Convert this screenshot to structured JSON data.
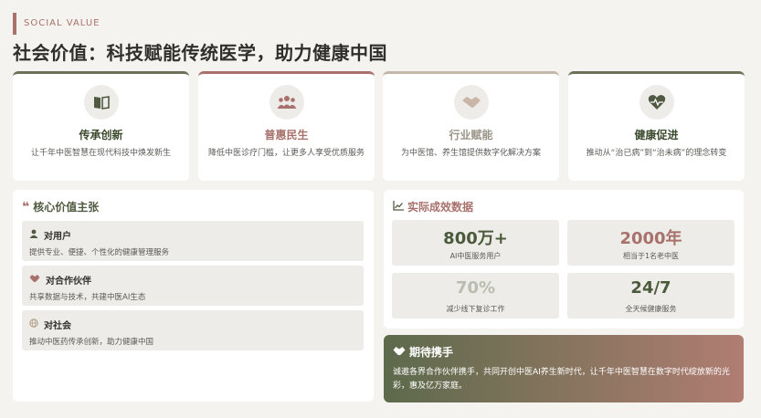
{
  "header": {
    "eyebrow": "SOCIAL VALUE",
    "title": "社会价值：科技赋能传统医学，助力健康中国"
  },
  "cards": [
    {
      "icon": "book-icon",
      "title": "传承创新",
      "desc": "让千年中医智慧在现代科技中焕发新生",
      "accent": "#6b7258"
    },
    {
      "icon": "users-icon",
      "title": "普惠民生",
      "desc": "降低中医诊疗门槛，让更多人享受优质服务",
      "accent": "#a8716b"
    },
    {
      "icon": "handshake-icon",
      "title": "行业赋能",
      "desc": "为中医馆、养生馆提供数字化解决方案",
      "accent": "#c4b8a8"
    },
    {
      "icon": "heart-pulse-icon",
      "title": "健康促进",
      "desc": "推动从“治已病”到“治未病”的理念转变",
      "accent": "#6b7258"
    }
  ],
  "core_values": {
    "title": "核心价值主张",
    "items": [
      {
        "icon": "user-icon",
        "title": "对用户",
        "desc": "提供专业、便捷、个性化的健康管理服务"
      },
      {
        "icon": "handshake-icon",
        "title": "对合作伙伴",
        "desc": "共享数据与技术，共建中医AI生态"
      },
      {
        "icon": "globe-icon",
        "title": "对社会",
        "desc": "推动中医药传承创新，助力健康中国"
      }
    ]
  },
  "results": {
    "title": "实际成效数据",
    "stats": [
      {
        "value": "800万+",
        "label": "AI中医服务用户",
        "color": "#4a5a3a"
      },
      {
        "value": "2000年",
        "label": "相当于1名老中医",
        "color": "#a8716b"
      },
      {
        "value": "70%",
        "label": "减少线下复诊工作",
        "color": "#b9bdb0"
      },
      {
        "value": "24/7",
        "label": "全天候健康服务",
        "color": "#4a5a3a"
      }
    ]
  },
  "cta": {
    "title": "期待携手",
    "text": "诚邀各界合作伙伴携手，共同开创中医AI养生新时代，让千年中医智慧在数字时代绽放新的光彩，惠及亿万家庭。"
  },
  "colors": {
    "olive": "#6b7258",
    "rose": "#a8716b",
    "background": "#f5f3ef",
    "tile": "#eeece8"
  }
}
